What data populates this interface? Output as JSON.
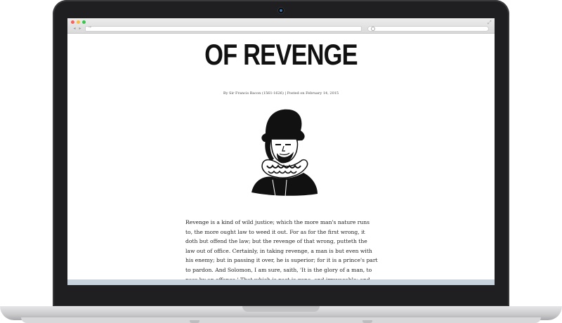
{
  "browser": {
    "back_label": "◂",
    "forward_label": "▸",
    "url_text": "",
    "search_text": ""
  },
  "article": {
    "title": "OF REVENGE",
    "byline": "By Sir Francis Bacon (1561-1626) | Posted on February 14, 2015",
    "portrait_alt": "portrait of Sir Francis Bacon",
    "body": "Revenge is a kind of wild justice; which the more man's nature runs to, the more ought law to weed it out. For as for the first wrong, it doth but offend the law; but the revenge of that wrong, putteth the law out of office. Certainly, in taking revenge, a man is but even with his enemy; but in passing it over, he is superior; for it is a prince's part to pardon. And Solomon, I am sure, saith, 'It is the glory of a man, to pass by an offence.' That which is past is gone, and irrevocable; and wise men have enough to do, with things present and to come; therefore they do but trifle with themselves, that labor in past matters. There is no man doth a wrong, for the wrong's sake; but thereby to purchase himself profit, or pleasure, or honor, or the like. Therefore why should I be angry with a"
  },
  "colors": {
    "traffic_red": "#fc605c",
    "traffic_yellow": "#fdbc40",
    "traffic_green": "#34c84a",
    "footer_band": "#c9d3dd"
  }
}
